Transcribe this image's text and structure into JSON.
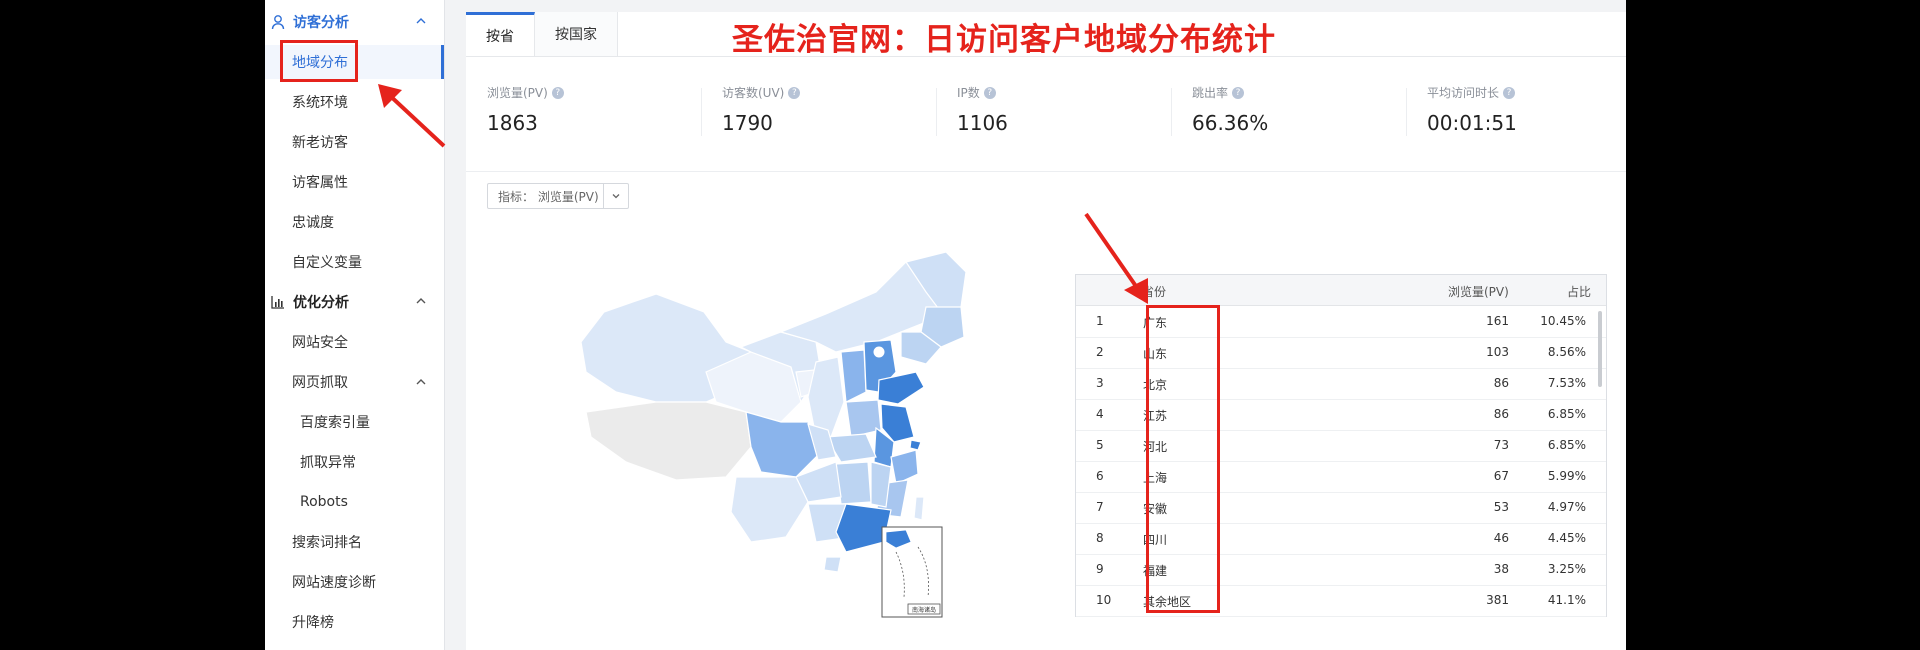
{
  "headline": "圣佐治官网：日访问客户地域分布统计",
  "sidebar": {
    "groups": [
      {
        "label": "访客分析",
        "icon": "user-icon"
      },
      {
        "label": "优化分析",
        "icon": "bar-chart-icon"
      }
    ],
    "items": [
      {
        "label": "地域分布"
      },
      {
        "label": "系统环境"
      },
      {
        "label": "新老访客"
      },
      {
        "label": "访客属性"
      },
      {
        "label": "忠诚度"
      },
      {
        "label": "自定义变量"
      },
      {
        "label": "网站安全"
      },
      {
        "label": "网页抓取"
      },
      {
        "label": "百度索引量"
      },
      {
        "label": "抓取异常"
      },
      {
        "label": "Robots"
      },
      {
        "label": "搜索词排名"
      },
      {
        "label": "网站速度诊断"
      },
      {
        "label": "升降榜"
      }
    ]
  },
  "tabs": [
    {
      "label": "按省"
    },
    {
      "label": "按国家"
    }
  ],
  "metrics": [
    {
      "label": "浏览量(PV)",
      "value": "1863"
    },
    {
      "label": "访客数(UV)",
      "value": "1790"
    },
    {
      "label": "IP数",
      "value": "1106"
    },
    {
      "label": "跳出率",
      "value": "66.36%"
    },
    {
      "label": "平均访问时长",
      "value": "00:01:51"
    }
  ],
  "selector": {
    "label": "指标： 浏览量(PV)"
  },
  "map": {
    "inset_label": "南海诸岛"
  },
  "table": {
    "headers": {
      "province": "省份",
      "pv": "浏览量(PV)",
      "share": "占比"
    },
    "rows": [
      {
        "rank": "1",
        "province": "广东",
        "pv": "161",
        "share": "10.45%"
      },
      {
        "rank": "2",
        "province": "山东",
        "pv": "103",
        "share": "8.56%"
      },
      {
        "rank": "3",
        "province": "北京",
        "pv": "86",
        "share": "7.53%"
      },
      {
        "rank": "4",
        "province": "江苏",
        "pv": "86",
        "share": "6.85%"
      },
      {
        "rank": "5",
        "province": "河北",
        "pv": "73",
        "share": "6.85%"
      },
      {
        "rank": "6",
        "province": "上海",
        "pv": "67",
        "share": "5.99%"
      },
      {
        "rank": "7",
        "province": "安徽",
        "pv": "53",
        "share": "4.97%"
      },
      {
        "rank": "8",
        "province": "四川",
        "pv": "46",
        "share": "4.45%"
      },
      {
        "rank": "9",
        "province": "福建",
        "pv": "38",
        "share": "3.25%"
      },
      {
        "rank": "10",
        "province": "其余地区",
        "pv": "381",
        "share": "41.1%"
      }
    ]
  },
  "colors": {
    "accent": "#2f6fd6",
    "annotation": "#e5231c",
    "map_dark": "#3a7fd6",
    "map_light": "#dce8f8"
  }
}
